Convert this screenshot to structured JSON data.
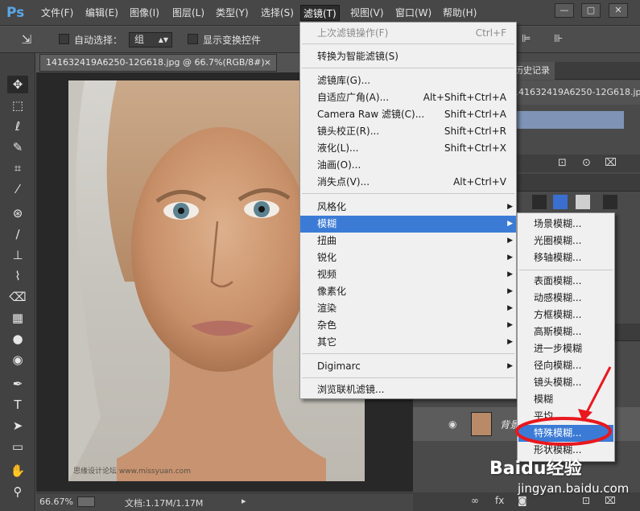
{
  "app": {
    "logo": "Ps",
    "menu": [
      "文件(F)",
      "编辑(E)",
      "图像(I)",
      "图层(L)",
      "类型(Y)",
      "选择(S)",
      "滤镜(T)",
      "视图(V)",
      "窗口(W)",
      "帮助(H)"
    ],
    "active_menu": "滤镜(T)",
    "window_buttons": [
      "—",
      "▢",
      "✕"
    ]
  },
  "options": {
    "auto_select_label": "自动选择：",
    "auto_select_value": "组",
    "show_transform_label": "显示变换控件"
  },
  "document": {
    "tab_title": "141632419A6250-12G618.jpg @ 66.7%(RGB/8#)",
    "tab_close": "×",
    "photo_caption": "思缘设计论坛 www.missyuan.com",
    "zoom": "66.67%",
    "doc_size": "文档:1.17M/1.17M"
  },
  "panels": {
    "history_tab": "历史记录",
    "history_file": "141632419A6250-12G618.jpg",
    "layer_name": "背景"
  },
  "filter_menu": {
    "items": [
      {
        "label": "上次滤镜操作(F)",
        "shortcut": "Ctrl+F",
        "disabled": true
      },
      {
        "label": "转换为智能滤镜(S)",
        "shortcut": ""
      },
      {
        "label": "滤镜库(G)...",
        "shortcut": ""
      },
      {
        "label": "自适应广角(A)...",
        "shortcut": "Alt+Shift+Ctrl+A"
      },
      {
        "label": "Camera Raw 滤镜(C)...",
        "shortcut": "Shift+Ctrl+A"
      },
      {
        "label": "镜头校正(R)...",
        "shortcut": "Shift+Ctrl+R"
      },
      {
        "label": "液化(L)...",
        "shortcut": "Shift+Ctrl+X"
      },
      {
        "label": "油画(O)...",
        "shortcut": ""
      },
      {
        "label": "消失点(V)...",
        "shortcut": "Alt+Ctrl+V"
      },
      {
        "label": "风格化",
        "submenu": true
      },
      {
        "label": "模糊",
        "submenu": true,
        "highlighted": true
      },
      {
        "label": "扭曲",
        "submenu": true
      },
      {
        "label": "锐化",
        "submenu": true
      },
      {
        "label": "视频",
        "submenu": true
      },
      {
        "label": "像素化",
        "submenu": true
      },
      {
        "label": "渲染",
        "submenu": true
      },
      {
        "label": "杂色",
        "submenu": true
      },
      {
        "label": "其它",
        "submenu": true
      },
      {
        "label": "Digimarc",
        "submenu": true
      },
      {
        "label": "浏览联机滤镜...",
        "shortcut": ""
      }
    ]
  },
  "blur_submenu": {
    "items": [
      "场景模糊...",
      "光圈模糊...",
      "移轴模糊...",
      "表面模糊...",
      "动感模糊...",
      "方框模糊...",
      "高斯模糊...",
      "进一步模糊",
      "径向模糊...",
      "镜头模糊...",
      "模糊",
      "平均",
      "特殊模糊...",
      "形状模糊..."
    ],
    "highlighted_index": 12
  },
  "annotation": {
    "color": "#e8181e"
  },
  "watermark": {
    "brand": "Baidu经验",
    "url": "jingyan.baidu.com"
  },
  "colors": {
    "menu_highlight": "#3b7bd6",
    "menu_bg": "#f0f0f0",
    "ui_dark": "#474747"
  }
}
